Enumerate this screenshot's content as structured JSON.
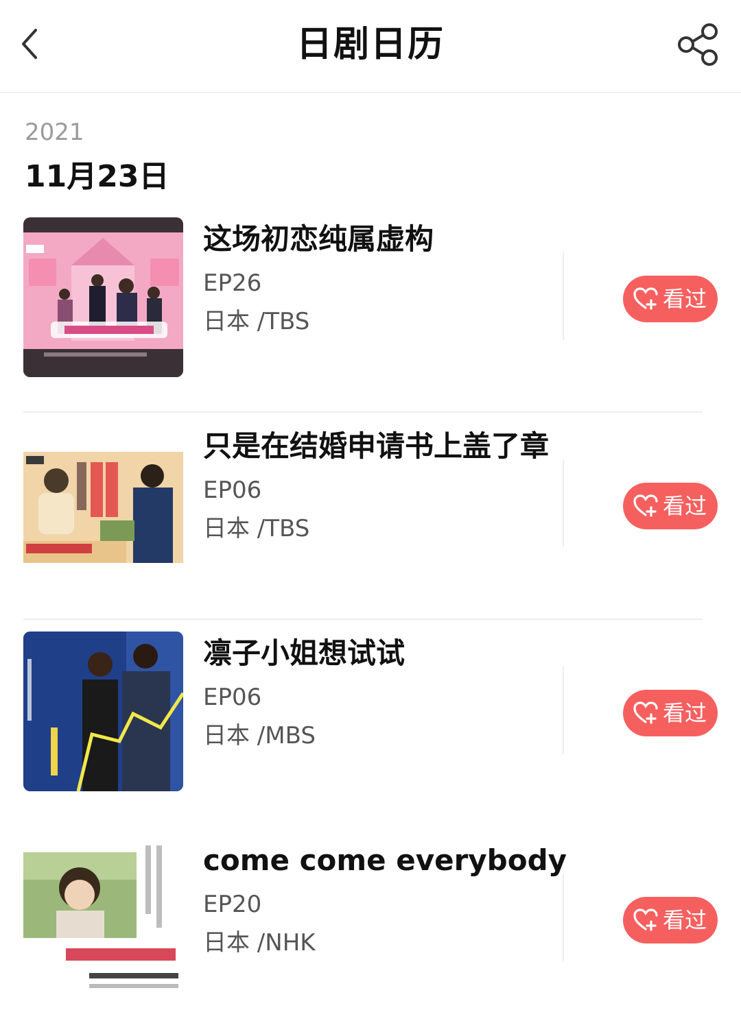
{
  "header": {
    "title": "日剧日历",
    "back_icon": "chevron-left-icon",
    "share_icon": "share-icon"
  },
  "section": {
    "year": "2021",
    "date": "11月23日"
  },
  "dramas": [
    {
      "title": "这场初恋纯属虚构",
      "episode": "EP26",
      "country": "日本 /TBS",
      "button_label": "看过",
      "poster_alt": "这场初恋纯属虚构 poster"
    },
    {
      "title": "只是在结婚申请书上盖了章",
      "episode": "EP06",
      "country": "日本 /TBS",
      "button_label": "看过",
      "poster_alt": "只是在结婚申请书上盖了章 poster"
    },
    {
      "title": "凛子小姐想试试",
      "episode": "EP06",
      "country": "日本 /MBS",
      "button_label": "看过",
      "poster_alt": "凛子小姐想试试 poster"
    },
    {
      "title": "come come everybody",
      "episode": "EP20",
      "country": "日本 /NHK",
      "button_label": "看过",
      "poster_alt": "come come everybody poster"
    }
  ],
  "colors": {
    "accent": "#f5605f",
    "muted_text": "#9a9a9a"
  }
}
